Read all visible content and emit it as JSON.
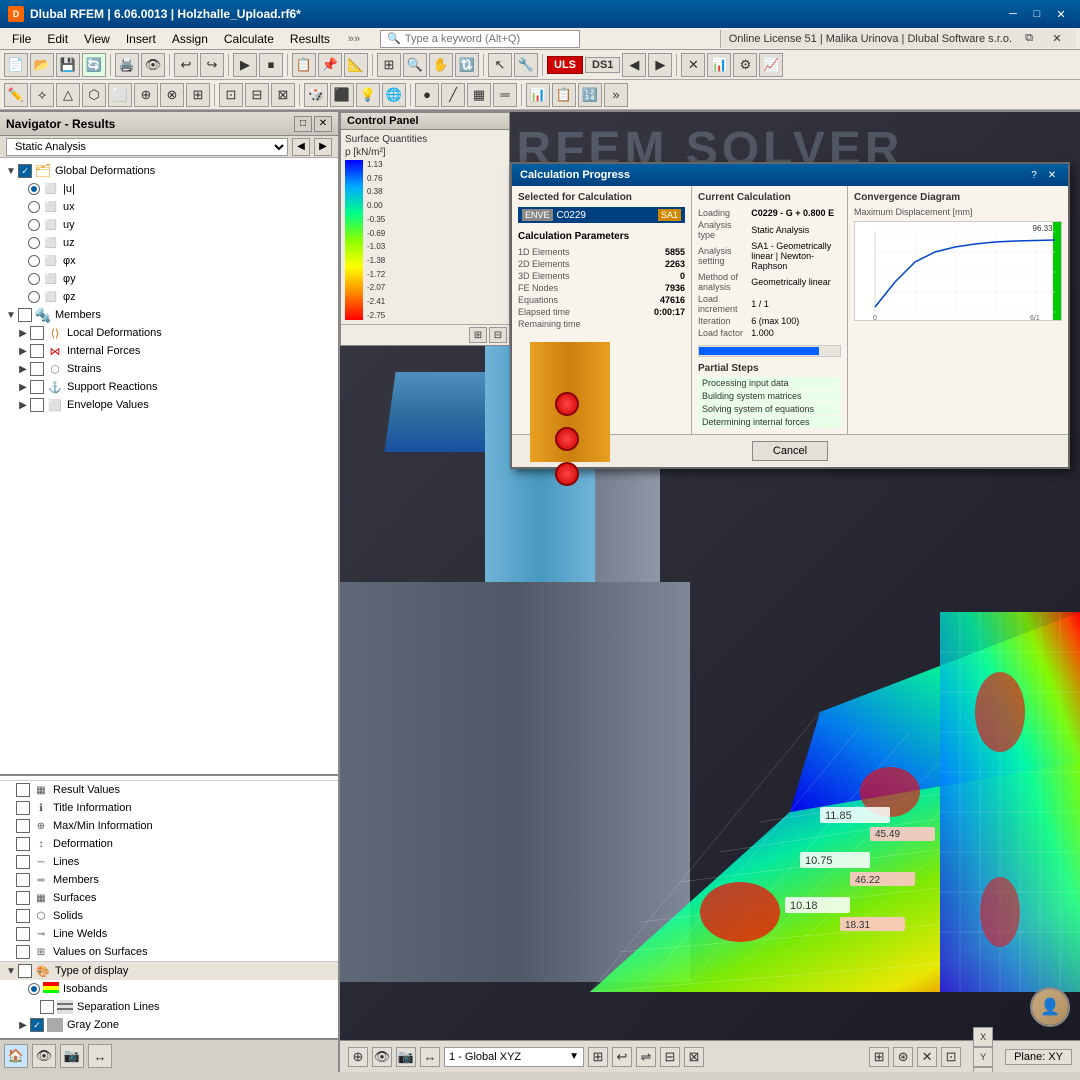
{
  "titlebar": {
    "icon_label": "D",
    "title": "Dlubal RFEM | 6.06.0013 | Holzhalle_Upload.rf6*",
    "controls": [
      "─",
      "□",
      "✕"
    ]
  },
  "menubar": {
    "items": [
      "File",
      "Edit",
      "View",
      "Insert",
      "Assign",
      "Calculate",
      "Results"
    ],
    "search_placeholder": "Type a keyword (Alt+Q)",
    "license_text": "Online License 51 | Malika Urinova | Dlubal Software s.r.o."
  },
  "toolbar1": {
    "buttons": [
      "📁",
      "💾",
      "🖨️",
      "↩",
      "↪",
      "▶",
      "⏹",
      "📋",
      "📐"
    ]
  },
  "toolbar2": {
    "uls_label": "ULS",
    "ds_label": "DS1"
  },
  "navigator": {
    "title": "Navigator - Results",
    "dropdown_value": "Static Analysis",
    "tree": {
      "global_deformations": {
        "label": "Global Deformations",
        "checked": true,
        "children": [
          {
            "label": "|u|",
            "radio": true,
            "checked": true
          },
          {
            "label": "ux",
            "radio": true
          },
          {
            "label": "uy",
            "radio": true
          },
          {
            "label": "uz",
            "radio": true
          },
          {
            "label": "φx",
            "radio": true
          },
          {
            "label": "φy",
            "radio": true
          },
          {
            "label": "φz",
            "radio": true
          }
        ]
      },
      "members": {
        "label": "Members",
        "checked": false,
        "children": [
          {
            "label": "Local Deformations",
            "checked": false
          },
          {
            "label": "Internal Forces",
            "checked": false
          },
          {
            "label": "Strains",
            "checked": false
          },
          {
            "label": "Support Reactions",
            "checked": false
          },
          {
            "label": "Envelope Values",
            "checked": false
          }
        ]
      }
    },
    "bottom_items": [
      {
        "label": "Result Values",
        "checked": false,
        "icon": "grid"
      },
      {
        "label": "Title Information",
        "checked": false,
        "icon": "info"
      },
      {
        "label": "Max/Min Information",
        "checked": false,
        "icon": "info2"
      },
      {
        "label": "Deformation",
        "checked": false,
        "icon": "deform"
      },
      {
        "label": "Lines",
        "checked": false,
        "icon": "line"
      },
      {
        "label": "Members",
        "checked": false,
        "icon": "member"
      },
      {
        "label": "Surfaces",
        "checked": false,
        "icon": "surface"
      },
      {
        "label": "Solids",
        "checked": false,
        "icon": "solid"
      },
      {
        "label": "Line Welds",
        "checked": false,
        "icon": "weld"
      },
      {
        "label": "Values on Surfaces",
        "checked": false,
        "icon": "values"
      }
    ],
    "type_display": {
      "label": "Type of display",
      "checked": false,
      "children": [
        {
          "label": "Isobands",
          "radio": true,
          "checked": true,
          "icon": "isoband"
        },
        {
          "label": "Separation Lines",
          "checked": false,
          "icon": "seplines"
        },
        {
          "label": "Gray Zone",
          "checked": true,
          "icon": "grayzone"
        }
      ]
    }
  },
  "control_panel": {
    "title": "Control Panel",
    "section_label": "Surface Quantities",
    "unit": "p [kN/m²]",
    "values": [
      "1.13",
      "0.76",
      "0.38",
      "0.00",
      "-0.35",
      "-0.69",
      "-1.03",
      "-1.38",
      "-1.72",
      "-2.07",
      "-2.41",
      "-2.75"
    ]
  },
  "calc_dialog": {
    "title": "Calculation Progress",
    "selected_label": "Selected for Calculation",
    "load_combo": "SA1",
    "current_calc_title": "Current Calculation",
    "fields": {
      "loading": "C0229 - G + 0.800 E",
      "analysis_type": "Static Analysis",
      "analysis_setting": "SA1 - Geometrically linear | Newton-Raphson",
      "method": "Geometrically linear",
      "load_increment": "1 / 1",
      "iteration": "6 (max 100)",
      "load_factor": "1.000"
    },
    "partial_steps": {
      "title": "Partial Steps",
      "steps": [
        "Processing input data",
        "Building system matrices",
        "Solving system of equations",
        "Determining internal forces"
      ]
    },
    "params_title": "Calculation Parameters",
    "params": {
      "elements_1d": "5855",
      "elements_2d": "2263",
      "elements_3d": "0",
      "fe_nodes": "7936",
      "equations": "47616",
      "elapsed": "0:00:17",
      "remaining": ""
    },
    "convergence_title": "Convergence Diagram",
    "convergence_value": "Maximum Displacement [mm]",
    "convergence_max": "96.337",
    "cancel_label": "Cancel"
  },
  "viewport": {
    "solver_watermark": "RFEM SOLVER",
    "plane_label": "Plane: XY",
    "fem_values": {
      "v1": "11.85",
      "v2": "45.49",
      "v3": "10.75",
      "v4": "46.22",
      "v5": "10.18",
      "v6": "18.31"
    }
  },
  "status_bar": {
    "view_label": "1 - Global XYZ",
    "plane_label": "Plane: XY",
    "icons": [
      "home",
      "eye",
      "camera",
      "arrow"
    ]
  }
}
